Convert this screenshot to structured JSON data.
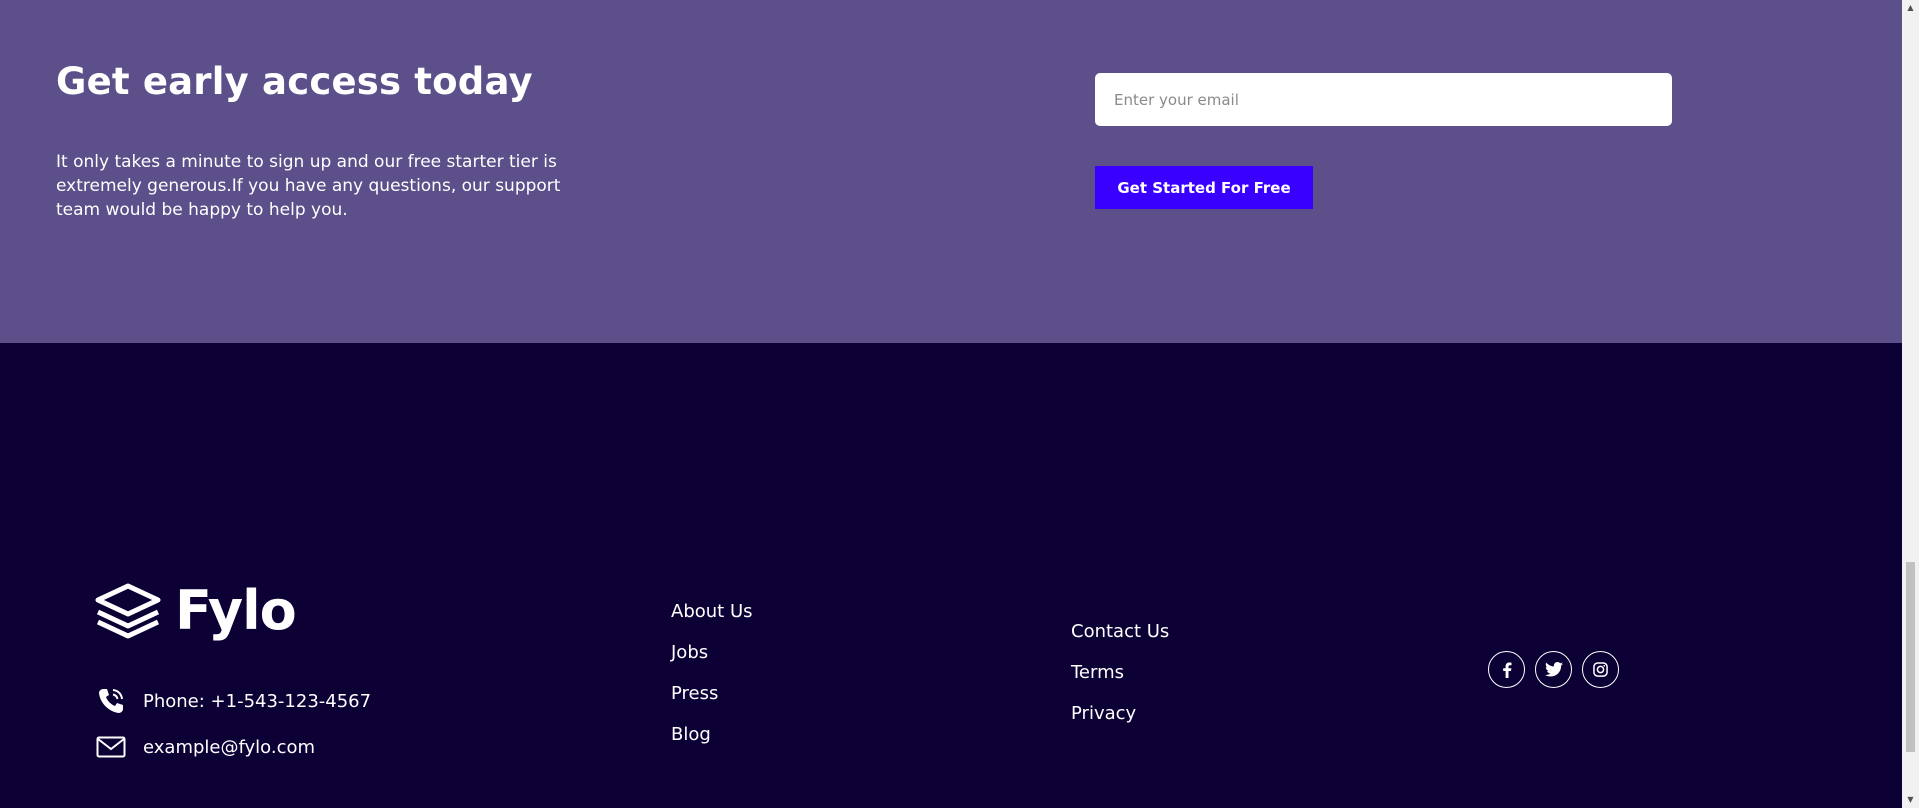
{
  "cta": {
    "title": "Get early access today",
    "text": "It only takes a minute to sign up and our free starter tier is extremely generous.If you have any questions, our support team would be happy to help you.",
    "email_placeholder": "Enter your email",
    "button_label": "Get Started For Free"
  },
  "footer": {
    "logo_text": "Fylo",
    "phone": "Phone: +1-543-123-4567",
    "email": "example@fylo.com",
    "links_col1": [
      "About Us",
      "Jobs",
      "Press",
      "Blog"
    ],
    "links_col2": [
      "Contact Us",
      "Terms",
      "Privacy"
    ],
    "social": [
      "facebook-icon",
      "twitter-icon",
      "instagram-icon"
    ]
  },
  "colors": {
    "cta_bg": "#5c4f8a",
    "footer_bg": "#0c0035",
    "button_bg": "#3a00ff"
  }
}
